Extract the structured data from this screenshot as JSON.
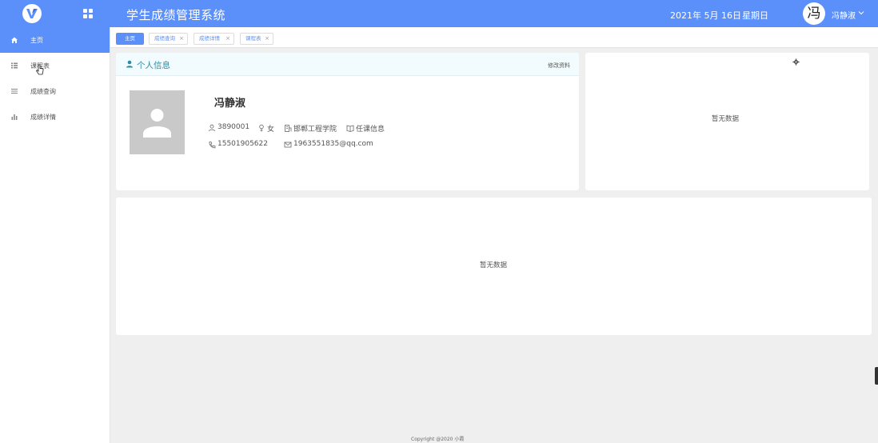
{
  "header": {
    "title": "学生成绩管理系统",
    "date": "2021年 5月 16日",
    "weekday": "星期日",
    "avatar_char": "冯",
    "user_name": "冯静淑"
  },
  "sidebar": {
    "items": [
      {
        "label": "主页",
        "icon": "home-icon"
      },
      {
        "label": "课程表",
        "icon": "table-icon"
      },
      {
        "label": "成绩查询",
        "icon": "list-icon"
      },
      {
        "label": "成绩详情",
        "icon": "bar-chart-icon"
      }
    ]
  },
  "tabs": [
    {
      "label": "主页",
      "active": true
    },
    {
      "label": "成绩查询",
      "close": "×"
    },
    {
      "label": "成绩详情",
      "close": "×"
    },
    {
      "label": "课程表",
      "close": "×"
    }
  ],
  "profile": {
    "title": "个人信息",
    "edit_label": "修改资料",
    "name": "冯静淑",
    "id": "3890001",
    "gender": "女",
    "college": "邯郸工程学院",
    "course_info": "任课信息",
    "phone": "15501905622",
    "email": "1963551835@qq.com"
  },
  "widgets": {
    "right_empty": "暂无数据",
    "bottom_empty": "暂无数据"
  },
  "footer": {
    "copyright": "Copyright @2020 小霞"
  },
  "colors": {
    "accent": "#5b8ff9",
    "card_title": "#2b8ba3"
  }
}
